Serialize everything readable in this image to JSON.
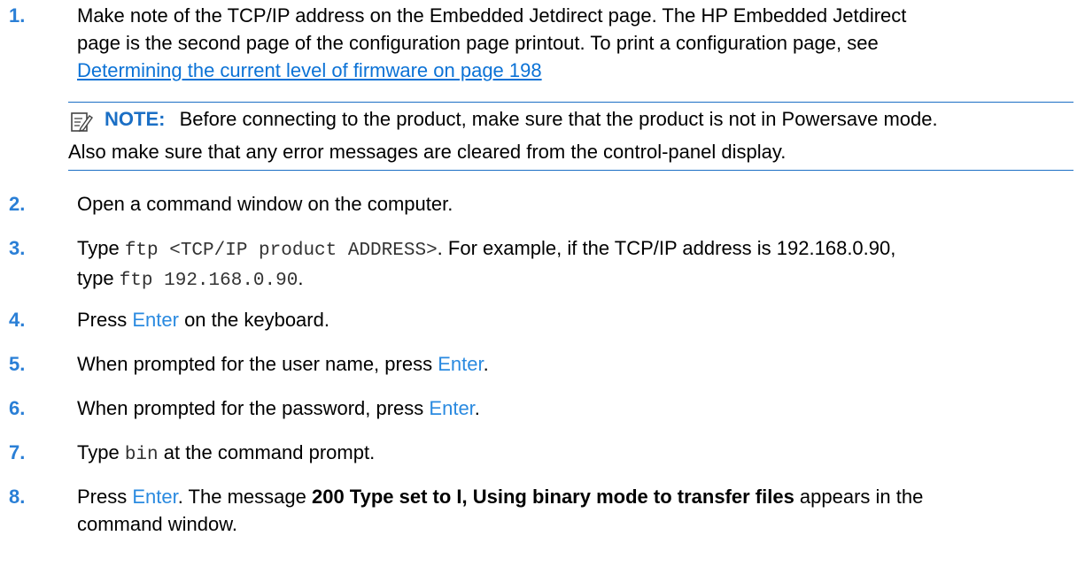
{
  "steps": [
    {
      "num": "1.",
      "text_a": "Make note of the TCP/IP address on the Embedded Jetdirect page. The HP Embedded Jetdirect",
      "text_b": "page is the second page of the configuration page printout. To print a configuration page, see",
      "link": "Determining the current level of firmware  on page 198"
    },
    {
      "num": "2.",
      "text": "Open a command window on the computer."
    },
    {
      "num": "3.",
      "pre1": "Type ",
      "code1": "ftp <TCP/IP product ADDRESS>",
      "mid1": ". For example, if the TCP/IP address is 192.168.0.90,",
      "pre2": "type ",
      "code2": "ftp 192.168.0.90",
      "post2": "."
    },
    {
      "num": "4.",
      "pre": "Press ",
      "key": "Enter",
      "post": " on the keyboard."
    },
    {
      "num": "5.",
      "pre": "When prompted for the user name, press ",
      "key": "Enter",
      "post": "."
    },
    {
      "num": "6.",
      "pre": "When prompted for the password, press ",
      "key": "Enter",
      "post": "."
    },
    {
      "num": "7.",
      "pre": "Type ",
      "code": "bin",
      "post": " at the command prompt."
    },
    {
      "num": "8.",
      "pre": "Press ",
      "key": "Enter",
      "mid": ". The message ",
      "bold": "200 Type set to I, Using binary mode to transfer files",
      "post": " appears in the",
      "line2": "command window."
    }
  ],
  "note": {
    "icon": "note-pencil-icon",
    "label": "NOTE:",
    "line1": "Before connecting to the product, make sure that the product is not in Powersave mode.",
    "line2": "Also make sure that any error messages are cleared from the control-panel display.",
    "accent": "#1b6fc5"
  }
}
